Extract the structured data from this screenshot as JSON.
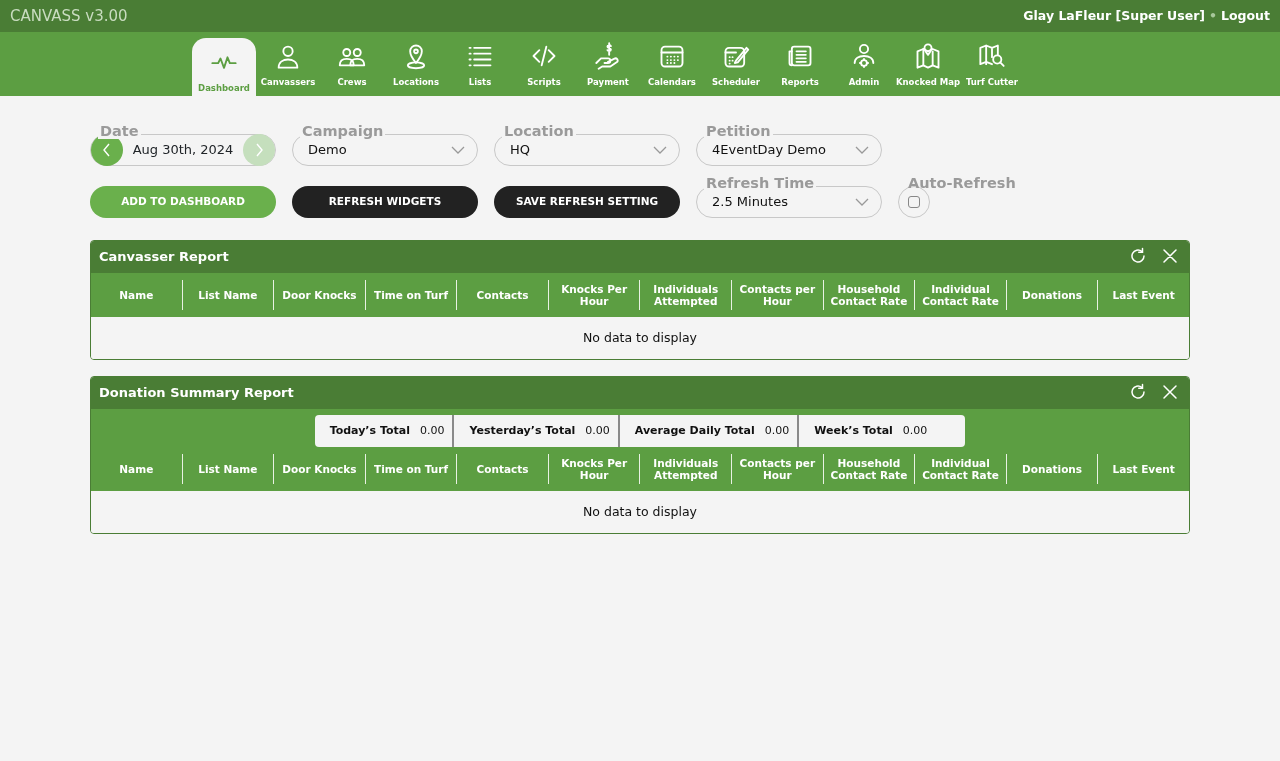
{
  "app": {
    "title": "CANVASS v3.00",
    "user": "Glay LaFleur [Super User]",
    "separator": "•",
    "logout": "Logout"
  },
  "nav": [
    {
      "label": "Dashboard",
      "selected": true
    },
    {
      "label": "Canvassers",
      "selected": false
    },
    {
      "label": "Crews",
      "selected": false
    },
    {
      "label": "Locations",
      "selected": false
    },
    {
      "label": "Lists",
      "selected": false
    },
    {
      "label": "Scripts",
      "selected": false
    },
    {
      "label": "Payment",
      "selected": false
    },
    {
      "label": "Calendars",
      "selected": false
    },
    {
      "label": "Scheduler",
      "selected": false
    },
    {
      "label": "Reports",
      "selected": false
    },
    {
      "label": "Admin",
      "selected": false
    },
    {
      "label": "Knocked Map",
      "selected": false
    },
    {
      "label": "Turf Cutter",
      "selected": false
    }
  ],
  "date": {
    "label": "Date",
    "value": "Aug 30th, 2024",
    "prev_disabled": false,
    "next_disabled": true
  },
  "selects": [
    {
      "label": "Campaign",
      "value": "Demo"
    },
    {
      "label": "Location",
      "value": "HQ"
    },
    {
      "label": "Petition",
      "value": "4EventDay Demo"
    }
  ],
  "actions": [
    {
      "label": "ADD TO DASHBOARD",
      "kind": "primary"
    },
    {
      "label": "REFRESH WIDGETS",
      "kind": "dark"
    },
    {
      "label": "SAVE REFRESH SETTING",
      "kind": "dark"
    }
  ],
  "refresh_time": {
    "label": "Refresh Time",
    "value": "2.5 Minutes"
  },
  "auto_refresh": {
    "label": "Auto-Refresh",
    "checked": false
  },
  "widgets": [
    {
      "title": "Canvasser Report",
      "columns": [
        "Name",
        "List Name",
        "Door Knocks",
        "Time on Turf",
        "Contacts",
        "Knocks Per Hour",
        "Individuals Attempted",
        "Contacts per Hour",
        "Household Contact Rate",
        "Individual Contact Rate",
        "Donations",
        "Last Event"
      ],
      "empty_text": "No data to display"
    },
    {
      "title": "Donation Summary Report",
      "totals": [
        {
          "label": "Today’s Total",
          "value": "0.00"
        },
        {
          "label": "Yesterday’s Total",
          "value": "0.00"
        },
        {
          "label": "Average Daily Total",
          "value": "0.00"
        },
        {
          "label": "Week’s Total",
          "value": "0.00"
        }
      ],
      "columns": [
        "Name",
        "List Name",
        "Door Knocks",
        "Time on Turf",
        "Contacts",
        "Knocks Per Hour",
        "Individuals Attempted",
        "Contacts per Hour",
        "Household Contact Rate",
        "Individual Contact Rate",
        "Donations",
        "Last Event"
      ],
      "empty_text": "No data to display"
    }
  ]
}
